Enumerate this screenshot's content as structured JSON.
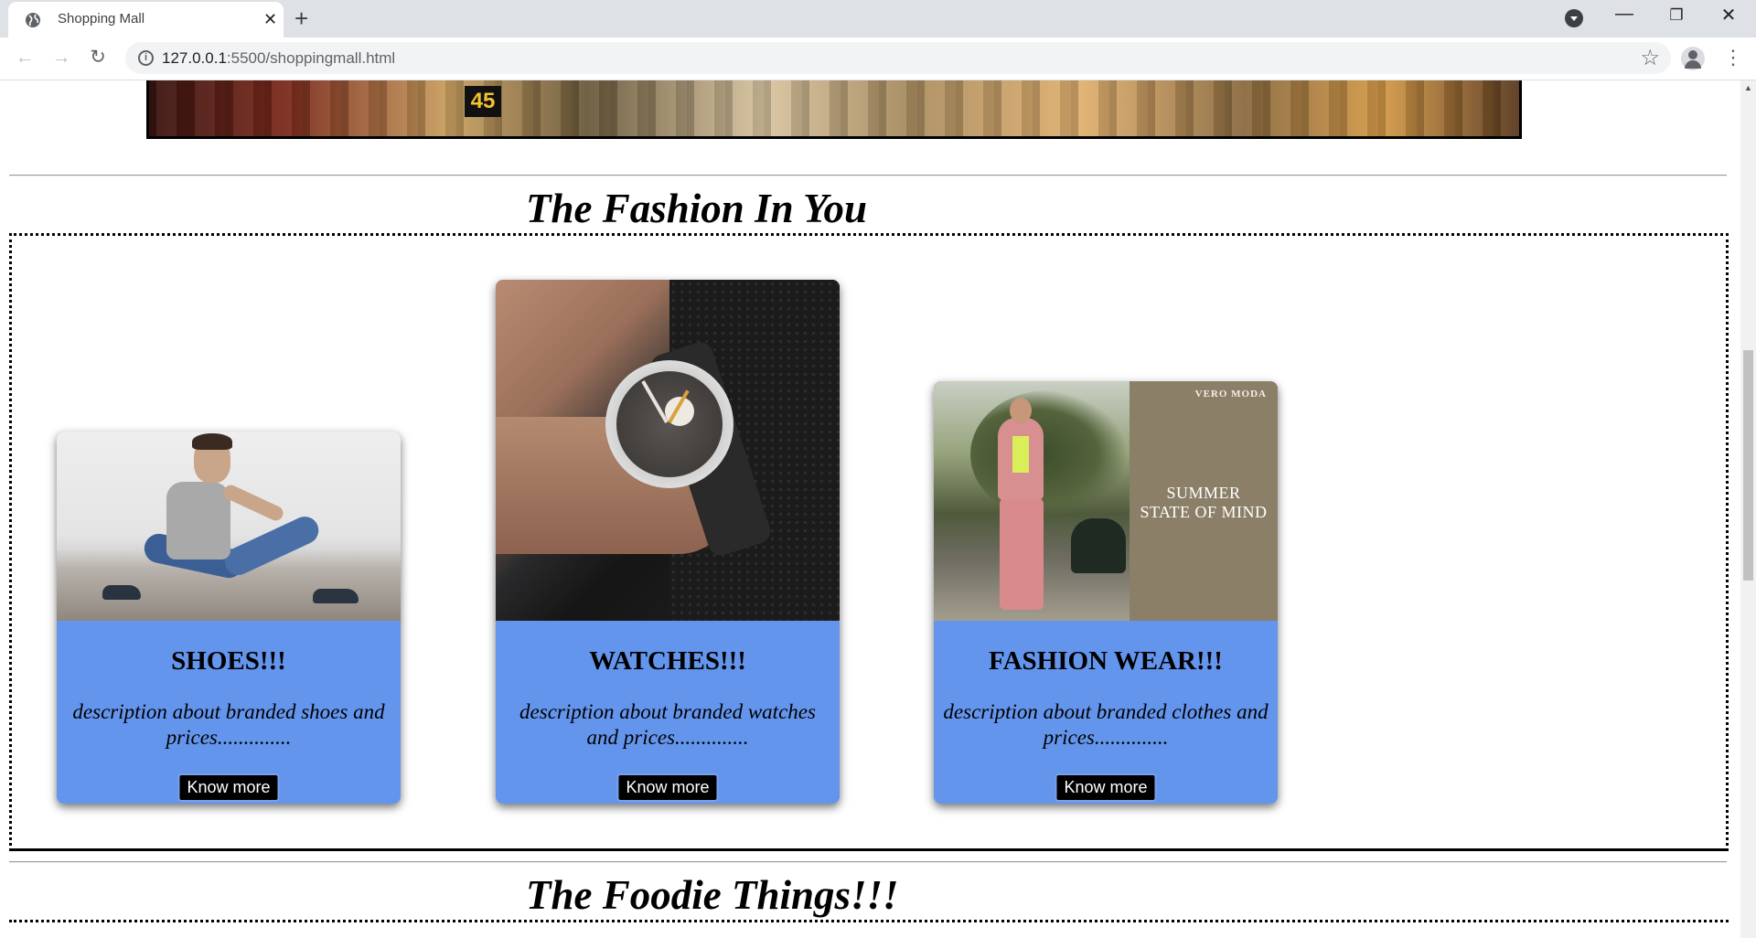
{
  "browser": {
    "tab_title": "Shopping Mall",
    "url_host": "127.0.0.1",
    "url_path": ":5500/shoppingmall.html",
    "new_tab_symbol": "+",
    "close_tab_symbol": "✕"
  },
  "banner": {
    "badge_text": "45"
  },
  "fashion_section": {
    "title": "The Fashion In You",
    "cards": [
      {
        "title": "SHOES!!!",
        "description": "description about branded shoes and prices..............",
        "button": "Know more",
        "image_icon": "man-sitting-image"
      },
      {
        "title": "WATCHES!!!",
        "description": "description about branded watches and prices..............",
        "button": "Know more",
        "image_icon": "wristwatch-image"
      },
      {
        "title": "FASHION WEAR!!!",
        "description": "description about branded clothes and prices..............",
        "button": "Know more",
        "image_icon": "woman-fashion-image",
        "image_brand": "VERO MODA",
        "image_slogan_line1": "SUMMER",
        "image_slogan_line2": "STATE OF MIND"
      }
    ]
  },
  "food_section": {
    "title": "The Foodie Things!!!"
  },
  "colors": {
    "card_body": "#6495ed",
    "button_bg": "#000000",
    "button_text": "#ffffff"
  }
}
